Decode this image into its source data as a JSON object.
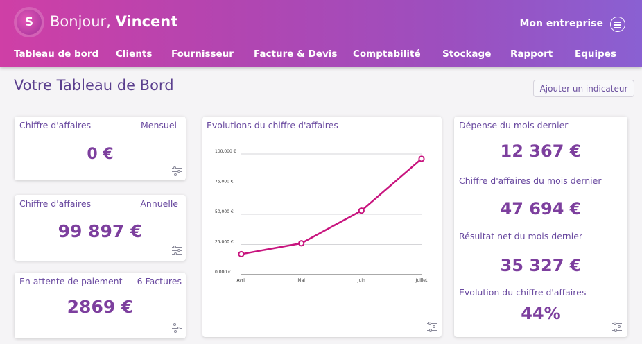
{
  "header": {
    "logo_letter": "S",
    "greeting": "Bonjour,",
    "user_name": "Vincent",
    "company": "Mon entreprise",
    "nav": [
      "Tableau de bord",
      "Clients",
      "Fournisseur",
      "Facture & Devis",
      "Comptabilité",
      "Stockage",
      "Rapport",
      "Equipes"
    ]
  },
  "page": {
    "title": "Votre Tableau de Bord",
    "add_indicator": "Ajouter un indicateur"
  },
  "cards": {
    "monthly": {
      "label": "Chiffre d'affaires",
      "period": "Mensuel",
      "value": "0 €"
    },
    "annual": {
      "label": "Chiffre d'affaires",
      "period": "Annuelle",
      "value": "99 897 €"
    },
    "pending": {
      "label": "En attente de paiement",
      "count": "6 Factures",
      "value": "2869 €"
    }
  },
  "chart_card": {
    "title": "Evolutions du chiffre d'affaires"
  },
  "chart_data": {
    "type": "line",
    "categories": [
      "Avril",
      "Mai",
      "Juin",
      "Juillet"
    ],
    "series": [
      {
        "values": [
          17000,
          26000,
          53000,
          96000
        ]
      }
    ],
    "yticks": [
      "100,000 €",
      "75,000 €",
      "50,000 €",
      "25,000 €",
      "0,000 €"
    ],
    "ylim": [
      0,
      100000
    ],
    "grid": true,
    "color": "#c8147e"
  },
  "stats": {
    "expense_label": "Dépense du mois dernier",
    "expense_value": "12 367 €",
    "revenue_label": "Chiffre d'affaires du mois dernier",
    "revenue_value": "47 694 €",
    "net_label": "Résultat net du mois dernier",
    "net_value": "35 327 €",
    "growth_label": "Evolution du chiffre d'affaires",
    "growth_value": "44%"
  },
  "icons": {
    "logo": "logo-icon",
    "menu": "menu-icon",
    "filter": "filter-icon"
  },
  "colors": {
    "accent": "#c8147e",
    "value": "#7d3f9e",
    "label": "#6a4aa0"
  }
}
